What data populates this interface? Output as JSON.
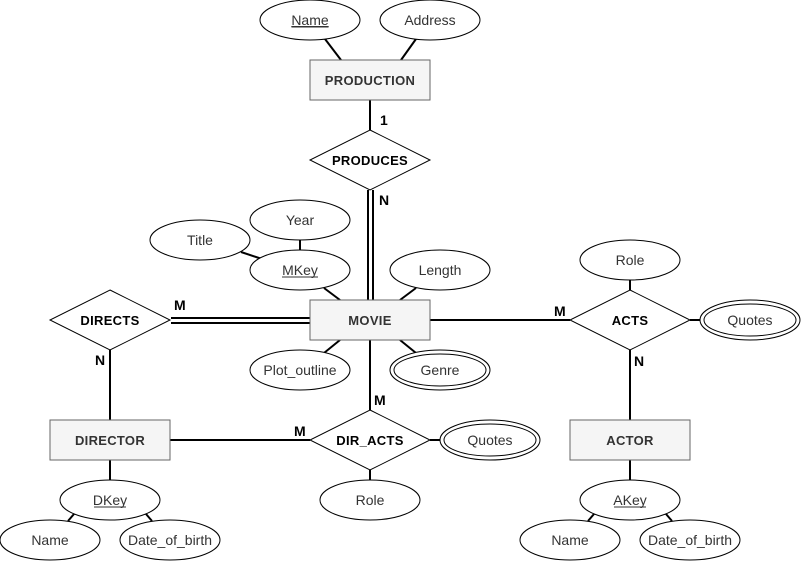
{
  "diagram": {
    "type": "er-diagram",
    "entities": {
      "production": "PRODUCTION",
      "movie": "MOVIE",
      "director": "DIRECTOR",
      "actor": "ACTOR"
    },
    "relationships": {
      "produces": "PRODUCES",
      "directs": "DIRECTS",
      "acts": "ACTS",
      "dir_acts": "DIR_ACTS"
    },
    "attributes": {
      "production_name": {
        "label": "Name",
        "key": true,
        "multivalued": false
      },
      "production_address": {
        "label": "Address",
        "key": false,
        "multivalued": false
      },
      "movie_title": {
        "label": "Title",
        "key": false,
        "multivalued": false
      },
      "movie_year": {
        "label": "Year",
        "key": false,
        "multivalued": false
      },
      "movie_mkey": {
        "label": "MKey",
        "key": true,
        "multivalued": false
      },
      "movie_length": {
        "label": "Length",
        "key": false,
        "multivalued": false
      },
      "movie_plot_outline": {
        "label": "Plot_outline",
        "key": false,
        "multivalued": false
      },
      "movie_genre": {
        "label": "Genre",
        "key": false,
        "multivalued": true
      },
      "acts_role": {
        "label": "Role",
        "key": false,
        "multivalued": false
      },
      "acts_quotes": {
        "label": "Quotes",
        "key": false,
        "multivalued": true
      },
      "dir_acts_quotes": {
        "label": "Quotes",
        "key": false,
        "multivalued": true
      },
      "dir_acts_role": {
        "label": "Role",
        "key": false,
        "multivalued": false
      },
      "director_dkey": {
        "label": "DKey",
        "key": true,
        "multivalued": false
      },
      "director_name": {
        "label": "Name",
        "key": false,
        "multivalued": false
      },
      "director_dob": {
        "label": "Date_of_birth",
        "key": false,
        "multivalued": false
      },
      "actor_akey": {
        "label": "AKey",
        "key": true,
        "multivalued": false
      },
      "actor_name": {
        "label": "Name",
        "key": false,
        "multivalued": false
      },
      "actor_dob": {
        "label": "Date_of_birth",
        "key": false,
        "multivalued": false
      }
    },
    "cardinalities": {
      "production_produces": "1",
      "produces_movie": "N",
      "directs_movie": "M",
      "directs_director": "N",
      "acts_movie": "M",
      "acts_actor": "N",
      "dir_acts_movie": "M",
      "dir_acts_director": "M"
    },
    "participation": {
      "produces_movie": "total",
      "directs_movie": "total"
    }
  }
}
